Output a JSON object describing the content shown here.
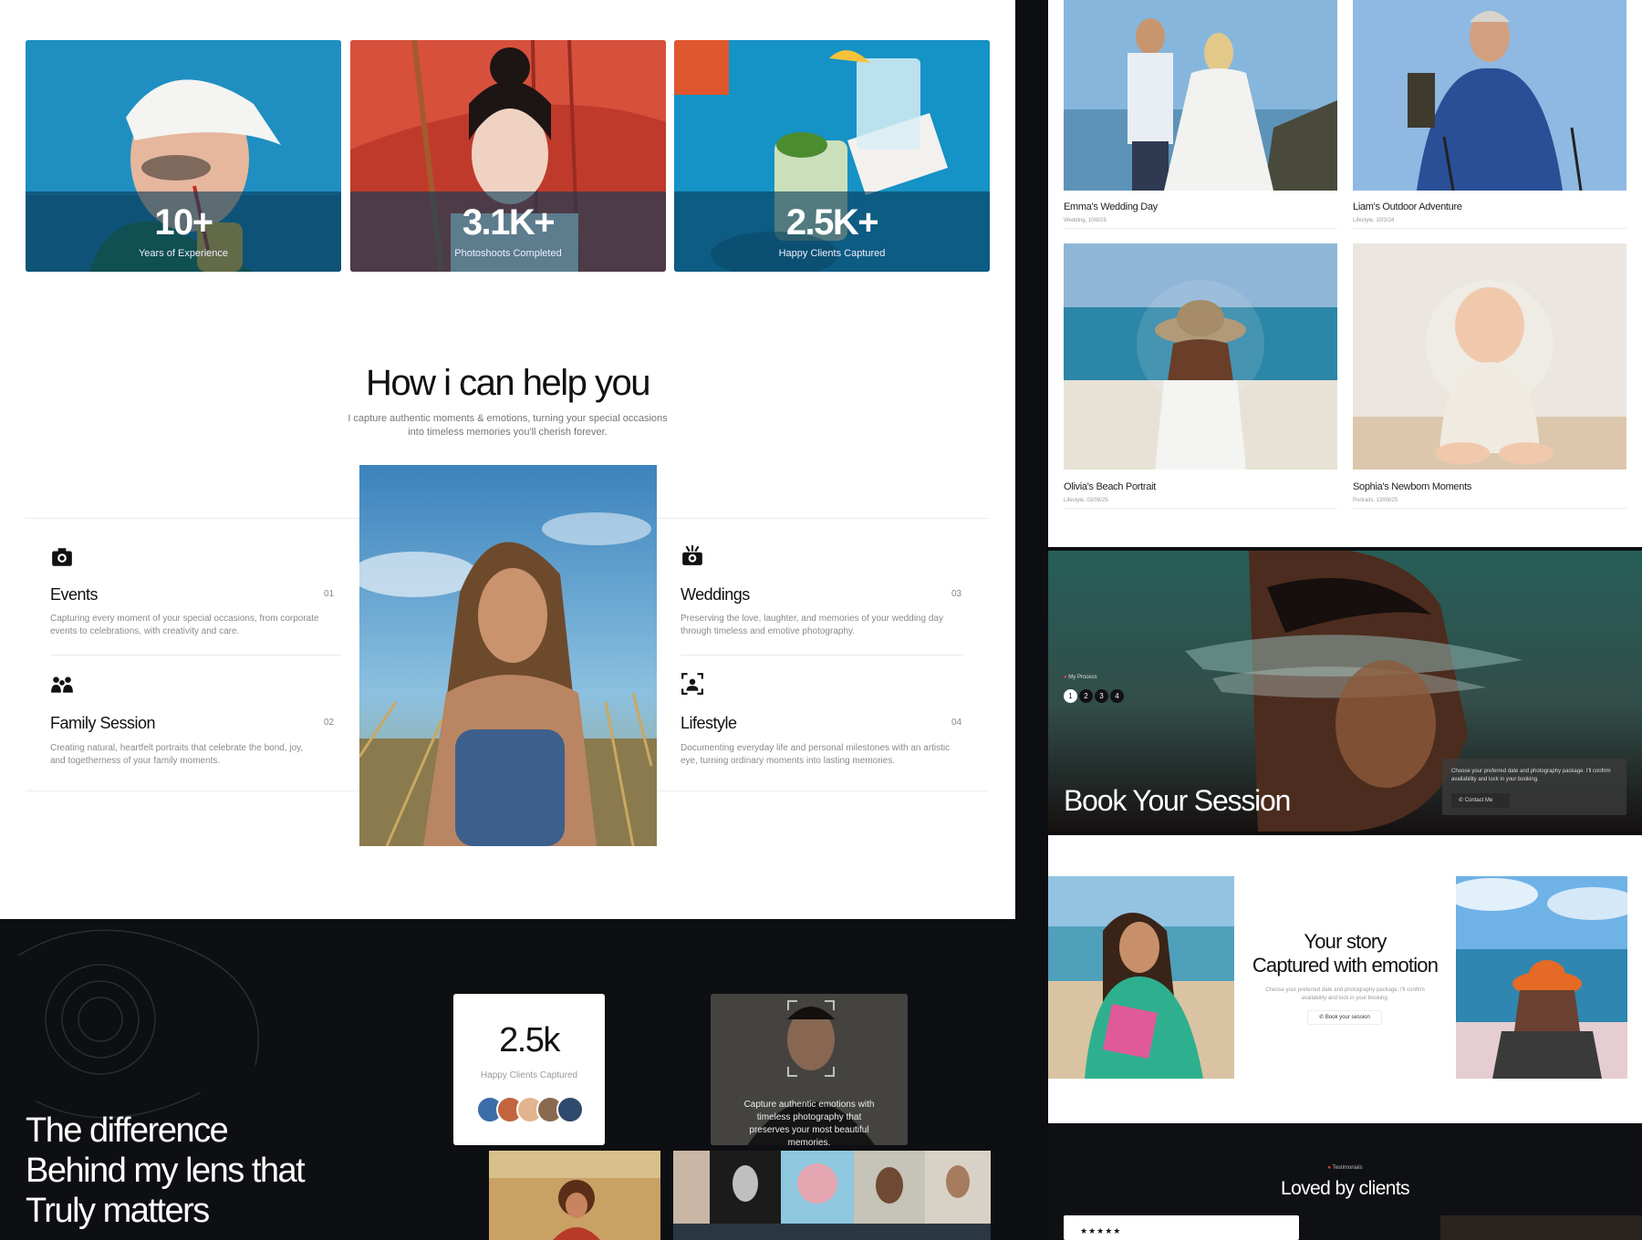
{
  "stats": [
    {
      "value": "10+",
      "label": "Years of Experience"
    },
    {
      "value": "3.1K+",
      "label": "Photoshoots Completed"
    },
    {
      "value": "2.5K+",
      "label": "Happy Clients Captured"
    }
  ],
  "help": {
    "title": "How i can help you",
    "subtitle": "I capture authentic moments & emotions, turning your special occasions into timeless memories you'll cherish forever."
  },
  "services": [
    {
      "icon": "camera-icon",
      "title": "Events",
      "num": "01",
      "desc": "Capturing every moment of your special occasions, from corporate events to celebrations, with creativity and care."
    },
    {
      "icon": "family-icon",
      "title": "Family Session",
      "num": "02",
      "desc": "Creating natural, heartfelt portraits that celebrate the bond, joy, and togetherness of your family moments."
    },
    {
      "icon": "wedding-camera-icon",
      "title": "Weddings",
      "num": "03",
      "desc": "Preserving the love, laughter, and memories of your wedding day through timeless and emotive photography."
    },
    {
      "icon": "focus-person-icon",
      "title": "Lifestyle",
      "num": "04",
      "desc": "Documenting everyday life and personal milestones with an artistic eye, turning ordinary moments into lasting memories."
    }
  ],
  "difference": {
    "line1": "The difference",
    "line2": "Behind my lens that",
    "line3": "Truly matters"
  },
  "happy_card": {
    "value": "2.5k",
    "label": "Happy Clients Captured"
  },
  "quote_card": {
    "text": "Capture authentic emotions with timeless photography that preserves your most beautiful memories."
  },
  "gallery": [
    {
      "name": "Emma's Wedding Day",
      "meta": "Wedding, 10/8/25"
    },
    {
      "name": "Liam's Outdoor Adventure",
      "meta": "Lifestyle, 10/3/24"
    },
    {
      "name": "Olivia's Beach Portrait",
      "meta": "Lifestyle, 03/08/25"
    },
    {
      "name": "Sophia's Newborn Moments",
      "meta": "Portraits, 13/08/25"
    }
  ],
  "book": {
    "label": "My Process",
    "steps": [
      "1",
      "2",
      "3",
      "4"
    ],
    "title": "Book Your Session",
    "text": "Choose your preferred date and photography package. I'll confirm availability and lock in your booking.",
    "button": "Contact Me"
  },
  "story": {
    "line1": "Your story",
    "line2": "Captured with emotion",
    "text": "Choose your preferred date and photography package. I'll confirm availability and lock in your booking.",
    "button": "Book your session"
  },
  "testimonials": {
    "label": "Testimonials",
    "title": "Loved by clients",
    "stars": "★★★★★"
  },
  "colors": {
    "accent": "#e4463a",
    "dark": "#0d0f12",
    "teal": "#2e6f68"
  }
}
